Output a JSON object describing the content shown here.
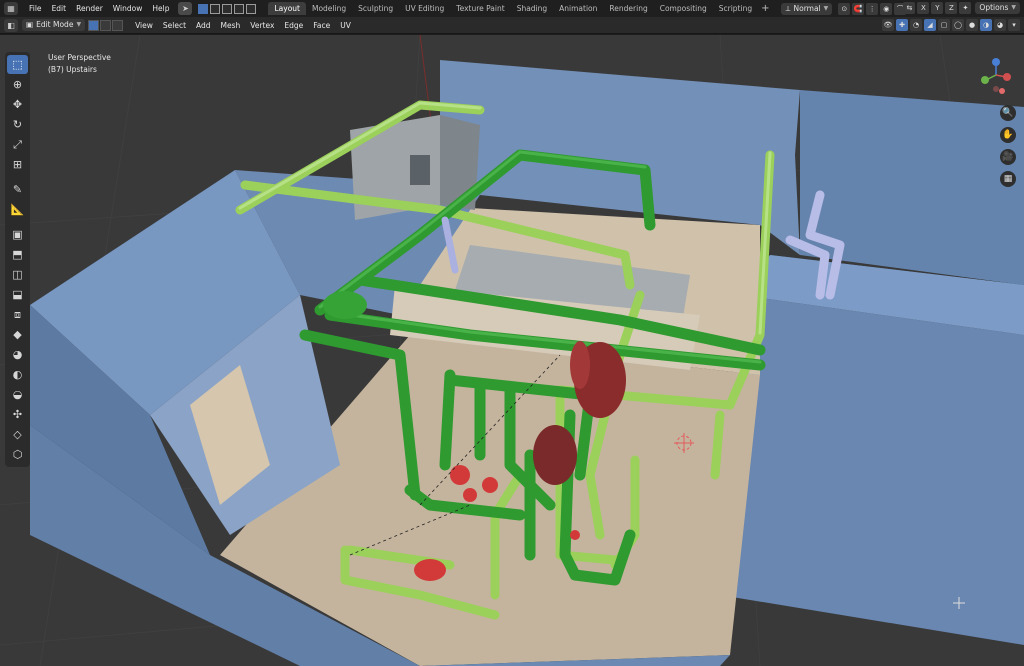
{
  "topbar": {
    "menu": [
      "File",
      "Edit",
      "Render",
      "Window",
      "Help"
    ],
    "workspaces": [
      "Layout",
      "Modeling",
      "Sculpting",
      "UV Editing",
      "Texture Paint",
      "Shading",
      "Animation",
      "Rendering",
      "Compositing",
      "Scripting"
    ],
    "active_workspace": "Layout",
    "add_tab": "+",
    "transform_orientation": "Normal",
    "options_label": "Options",
    "axes": [
      "X",
      "Y",
      "Z"
    ]
  },
  "viewport_header": {
    "mode": "Edit Mode",
    "menu": [
      "View",
      "Select",
      "Add",
      "Mesh",
      "Vertex",
      "Edge",
      "Face",
      "UV"
    ]
  },
  "viewport": {
    "title": "User Perspective",
    "object": "(B7) Upstairs"
  },
  "toolbar": {
    "tools": [
      {
        "name": "select-box-tool",
        "glyph": "⬚",
        "active": true
      },
      {
        "name": "cursor-tool",
        "glyph": "⊕",
        "active": false
      },
      {
        "name": "move-tool",
        "glyph": "✥",
        "active": false
      },
      {
        "name": "rotate-tool",
        "glyph": "↻",
        "active": false
      },
      {
        "name": "scale-tool",
        "glyph": "⤢",
        "active": false
      },
      {
        "name": "transform-tool",
        "glyph": "⊞",
        "active": false
      },
      {
        "name": "annotate-tool",
        "glyph": "✎",
        "active": false
      },
      {
        "name": "measure-tool",
        "glyph": "📐",
        "active": false
      },
      {
        "name": "add-cube-tool",
        "glyph": "▣",
        "active": false
      },
      {
        "name": "extrude-tool",
        "glyph": "⬒",
        "active": false
      },
      {
        "name": "inset-tool",
        "glyph": "◫",
        "active": false
      },
      {
        "name": "bevel-tool",
        "glyph": "⬓",
        "active": false
      },
      {
        "name": "loop-cut-tool",
        "glyph": "⧈",
        "active": false
      },
      {
        "name": "knife-tool",
        "glyph": "◆",
        "active": false
      },
      {
        "name": "poly-build-tool",
        "glyph": "◕",
        "active": false
      },
      {
        "name": "spin-tool",
        "glyph": "◐",
        "active": false
      },
      {
        "name": "smooth-tool",
        "glyph": "◒",
        "active": false
      },
      {
        "name": "edge-slide-tool",
        "glyph": "✣",
        "active": false
      },
      {
        "name": "shrink-tool",
        "glyph": "◇",
        "active": false
      },
      {
        "name": "shear-tool",
        "glyph": "⬡",
        "active": false
      }
    ]
  },
  "colors": {
    "viewport_bg": "#393939",
    "active_blue": "#4772b3",
    "pipe_dark_green": "#2f9a2f",
    "pipe_light_green": "#9bd05a",
    "wall_blue": "#6d8bb5",
    "floor_tan": "#c7b8a0"
  }
}
